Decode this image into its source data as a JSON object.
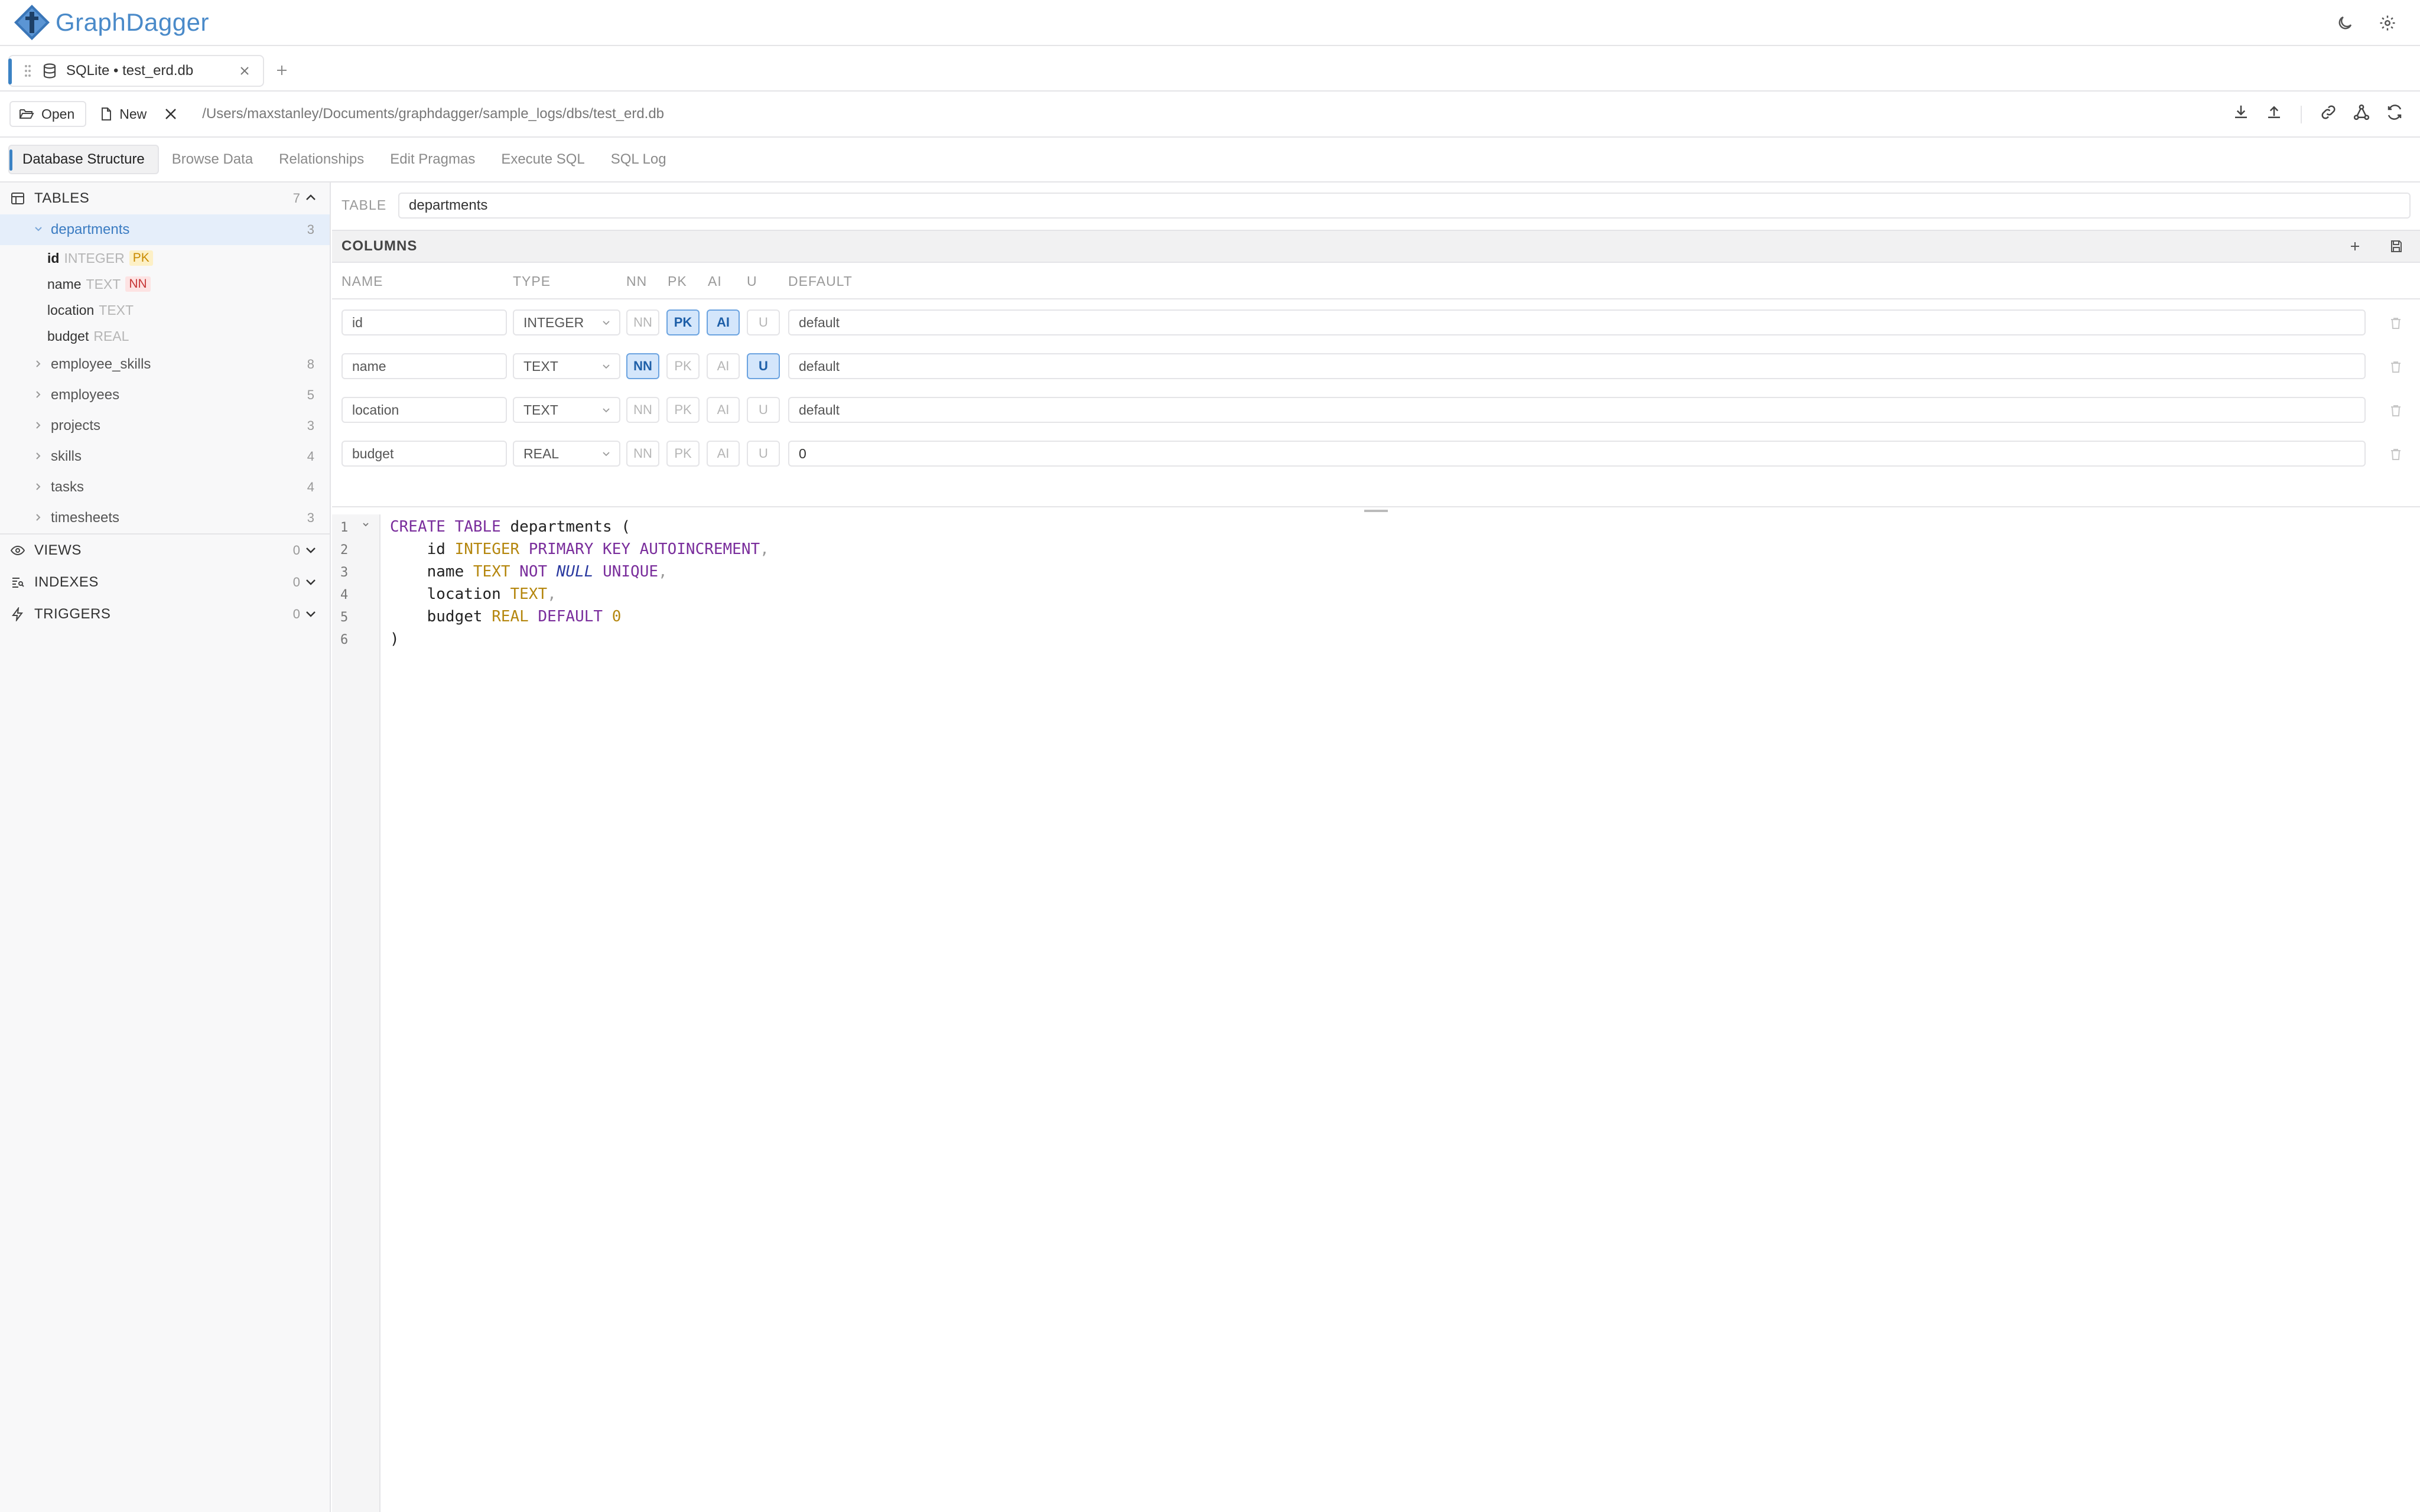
{
  "app": {
    "name": "GraphDagger",
    "header_icons": [
      "moon-icon",
      "gear-icon"
    ]
  },
  "connection_tab": {
    "label": "SQLite • test_erd.db",
    "icon": "database-icon"
  },
  "toolbar": {
    "open_label": "Open",
    "new_label": "New",
    "path": "/Users/maxstanley/Documents/graphdagger/sample_logs/dbs/test_erd.db",
    "right_icons": [
      "download-icon",
      "upload-icon",
      "link-icon",
      "graph-icon",
      "refresh-icon"
    ]
  },
  "view_tabs": [
    {
      "label": "Database Structure",
      "active": true
    },
    {
      "label": "Browse Data",
      "active": false
    },
    {
      "label": "Relationships",
      "active": false
    },
    {
      "label": "Edit Pragmas",
      "active": false
    },
    {
      "label": "Execute SQL",
      "active": false
    },
    {
      "label": "SQL Log",
      "active": false
    }
  ],
  "sidebar": {
    "tables_section": {
      "label": "TABLES",
      "count": "7"
    },
    "tables": [
      {
        "name": "departments",
        "count": "3"
      },
      {
        "name": "employee_skills",
        "count": "8"
      },
      {
        "name": "employees",
        "count": "5"
      },
      {
        "name": "projects",
        "count": "3"
      },
      {
        "name": "skills",
        "count": "4"
      },
      {
        "name": "tasks",
        "count": "4"
      },
      {
        "name": "timesheets",
        "count": "3"
      }
    ],
    "expanded_columns": [
      {
        "name": "id",
        "type": "INTEGER",
        "badge": "PK"
      },
      {
        "name": "name",
        "type": "TEXT",
        "badge": "NN"
      },
      {
        "name": "location",
        "type": "TEXT",
        "badge": ""
      },
      {
        "name": "budget",
        "type": "REAL",
        "badge": ""
      }
    ],
    "views_section": {
      "label": "VIEWS",
      "count": "0"
    },
    "indexes_section": {
      "label": "INDEXES",
      "count": "0"
    },
    "triggers_section": {
      "label": "TRIGGERS",
      "count": "0"
    }
  },
  "editor": {
    "table_label": "TABLE",
    "table_name": "departments",
    "columns_label": "COLUMNS",
    "grid_headers": {
      "name": "NAME",
      "type": "TYPE",
      "nn": "NN",
      "pk": "PK",
      "ai": "AI",
      "u": "U",
      "default": "DEFAULT"
    },
    "flag_labels": {
      "nn": "NN",
      "pk": "PK",
      "ai": "AI",
      "u": "U"
    },
    "columns": [
      {
        "name": "id",
        "type": "INTEGER",
        "nn": false,
        "pk": true,
        "ai": true,
        "u": false,
        "default": "default"
      },
      {
        "name": "name",
        "type": "TEXT",
        "nn": true,
        "pk": false,
        "ai": false,
        "u": true,
        "default": "default"
      },
      {
        "name": "location",
        "type": "TEXT",
        "nn": false,
        "pk": false,
        "ai": false,
        "u": false,
        "default": "default"
      },
      {
        "name": "budget",
        "type": "REAL",
        "nn": false,
        "pk": false,
        "ai": false,
        "u": false,
        "default": "0"
      }
    ]
  },
  "sql": {
    "line_numbers": [
      "1",
      "2",
      "3",
      "4",
      "5",
      "6"
    ],
    "l1": {
      "kw1": "CREATE TABLE",
      "name": " departments ("
    },
    "l2": {
      "col": "    id ",
      "ty": "INTEGER",
      "kw": " PRIMARY KEY AUTOINCREMENT",
      "pun": ","
    },
    "l3": {
      "col": "    name ",
      "ty": "TEXT",
      "kw": " NOT ",
      "nul": "NULL",
      "kw2": " UNIQUE",
      "pun": ","
    },
    "l4": {
      "col": "    location ",
      "ty": "TEXT",
      "pun": ","
    },
    "l5": {
      "col": "    budget ",
      "ty": "REAL",
      "kw": " DEFAULT ",
      "num": "0"
    },
    "l6": {
      "text": ")"
    }
  },
  "colors": {
    "accent": "#3b82c4",
    "logo": "#4a8ac9",
    "flag_on": "#d4e6fb",
    "pk_badge": "#c98a00",
    "nn_badge": "#c73737",
    "keyword": "#7a2e9c",
    "type": "#b5870f"
  }
}
